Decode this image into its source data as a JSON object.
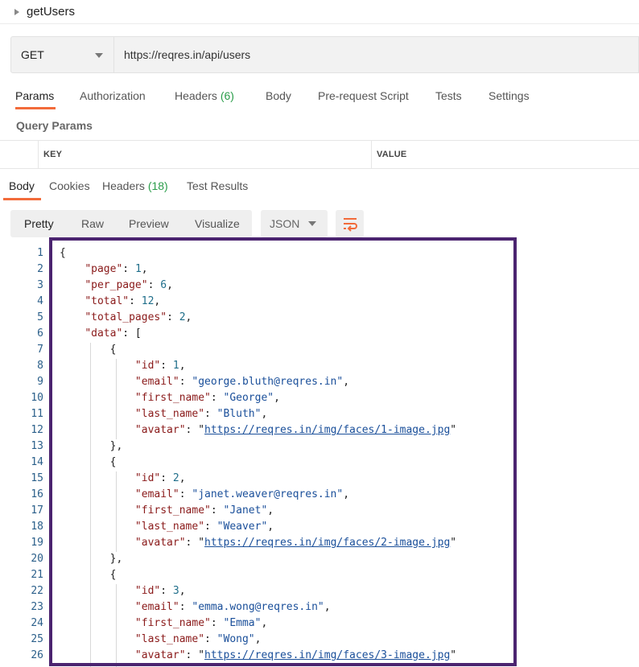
{
  "request": {
    "name": "getUsers"
  },
  "urlbar": {
    "method": "GET",
    "url": "https://reqres.in/api/users"
  },
  "request_tabs": [
    {
      "label": "Params",
      "active": true
    },
    {
      "label": "Authorization"
    },
    {
      "label": "Headers",
      "count": "(6)"
    },
    {
      "label": "Body"
    },
    {
      "label": "Pre-request Script"
    },
    {
      "label": "Tests"
    },
    {
      "label": "Settings"
    }
  ],
  "query_params": {
    "title": "Query Params",
    "columns": [
      "KEY",
      "VALUE"
    ]
  },
  "response_tabs": [
    {
      "label": "Body",
      "active": true
    },
    {
      "label": "Cookies"
    },
    {
      "label": "Headers",
      "count": "(18)"
    },
    {
      "label": "Test Results"
    }
  ],
  "view": {
    "modes": [
      "Pretty",
      "Raw",
      "Preview",
      "Visualize"
    ],
    "active_mode": "Pretty",
    "format": "JSON",
    "wrap_icon": "wrap-lines-icon"
  },
  "colors": {
    "accent": "#f26b3a",
    "count_green": "#2a9d4a",
    "highlight_border": "#4b2470"
  },
  "code_lines": [
    "{",
    "    \"page\": 1,",
    "    \"per_page\": 6,",
    "    \"total\": 12,",
    "    \"total_pages\": 2,",
    "    \"data\": [",
    "        {",
    "            \"id\": 1,",
    "            \"email\": \"george.bluth@reqres.in\",",
    "            \"first_name\": \"George\",",
    "            \"last_name\": \"Bluth\",",
    "            \"avatar\": \"https://reqres.in/img/faces/1-image.jpg\"",
    "        },",
    "        {",
    "            \"id\": 2,",
    "            \"email\": \"janet.weaver@reqres.in\",",
    "            \"first_name\": \"Janet\",",
    "            \"last_name\": \"Weaver\",",
    "            \"avatar\": \"https://reqres.in/img/faces/2-image.jpg\"",
    "        },",
    "        {",
    "            \"id\": 3,",
    "            \"email\": \"emma.wong@reqres.in\",",
    "            \"first_name\": \"Emma\",",
    "            \"last_name\": \"Wong\",",
    "            \"avatar\": \"https://reqres.in/img/faces/3-image.jpg\""
  ]
}
